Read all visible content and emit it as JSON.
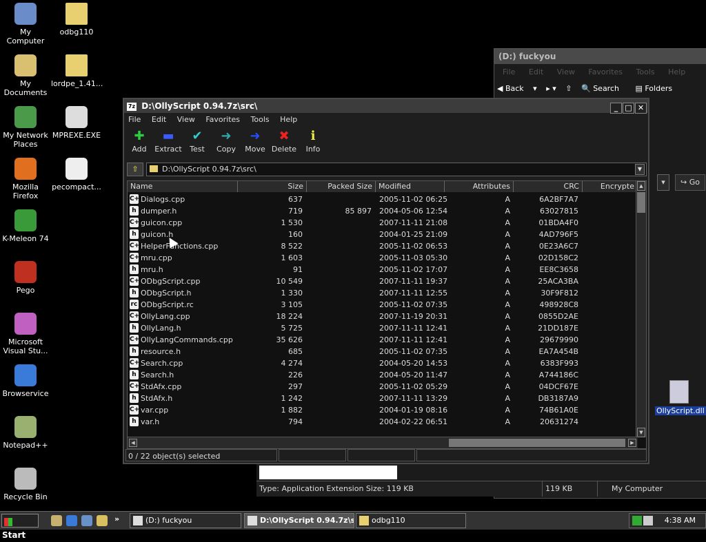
{
  "desktop_icons": [
    {
      "label": "My Computer",
      "icon": "computer-icon"
    },
    {
      "label": "odbg110",
      "icon": "folder-icon"
    },
    {
      "label": "My Documents",
      "icon": "documents-icon"
    },
    {
      "label": "lordpe_1.41...",
      "icon": "folder-icon"
    },
    {
      "label": "My Network Places",
      "icon": "network-icon"
    },
    {
      "label": "MPREXE.EXE",
      "icon": "exe-icon"
    },
    {
      "label": "Mozilla Firefox",
      "icon": "firefox-icon"
    },
    {
      "label": "pecompact...",
      "icon": "pecompact-icon"
    },
    {
      "label": "K-Meleon 74",
      "icon": "kmeleon-icon"
    },
    {
      "label": "Pego",
      "icon": "pego-icon"
    },
    {
      "label": "Microsoft Visual Stu...",
      "icon": "visual-studio-icon"
    },
    {
      "label": "Browservice",
      "icon": "ie-icon"
    },
    {
      "label": "Notepad++",
      "icon": "notepad-icon"
    },
    {
      "label": "Recycle Bin",
      "icon": "recycle-bin-icon"
    }
  ],
  "bg_window": {
    "title": "(D:) fuckyou",
    "menu": [
      "File",
      "Edit",
      "View",
      "Favorites",
      "Tools",
      "Help"
    ],
    "toolbar": {
      "back": "Back",
      "search": "Search",
      "folders": "Folders",
      "go": "Go"
    },
    "status": {
      "type": "Type: Application Extension Size: 119 KB",
      "size": "119 KB",
      "location": "My Computer"
    },
    "file_icon_label": "OllyScript.dll"
  },
  "main_window": {
    "title": "D:\\OllyScript 0.94.7z\\src\\",
    "app_icon_text": "7z",
    "menu": [
      "File",
      "Edit",
      "View",
      "Favorites",
      "Tools",
      "Help"
    ],
    "toolbar": [
      {
        "label": "Add",
        "icon": "plus-icon",
        "glyph": "✚",
        "color": "#2ecc40"
      },
      {
        "label": "Extract",
        "icon": "minus-icon",
        "glyph": "▬",
        "color": "#3a5cff"
      },
      {
        "label": "Test",
        "icon": "check-icon",
        "glyph": "✔",
        "color": "#3cc"
      },
      {
        "label": "Copy",
        "icon": "copy-arrow-icon",
        "glyph": "➜",
        "color": "#3aa"
      },
      {
        "label": "Move",
        "icon": "move-arrow-icon",
        "glyph": "➜",
        "color": "#2a4cff"
      },
      {
        "label": "Delete",
        "icon": "delete-x-icon",
        "glyph": "✖",
        "color": "#e22"
      },
      {
        "label": "Info",
        "icon": "info-icon",
        "glyph": "ℹ",
        "color": "#ee4"
      }
    ],
    "address": "D:\\OllyScript 0.94.7z\\src\\",
    "columns": {
      "name": "Name",
      "size": "Size",
      "packed": "Packed Size",
      "modified": "Modified",
      "attributes": "Attributes",
      "crc": "CRC",
      "encrypted": "Encrypte"
    },
    "files": [
      {
        "name": "Dialogs.cpp",
        "type": "C++",
        "size": "637",
        "packed": "",
        "modified": "2005-11-02 06:25",
        "attr": "A",
        "crc": "6A2BF7A7"
      },
      {
        "name": "dumper.h",
        "type": "h",
        "size": "719",
        "packed": "85 897",
        "modified": "2004-05-06 12:54",
        "attr": "A",
        "crc": "63027815"
      },
      {
        "name": "guicon.cpp",
        "type": "C++",
        "size": "1 530",
        "packed": "",
        "modified": "2007-11-11 21:08",
        "attr": "A",
        "crc": "01BDA4F0"
      },
      {
        "name": "guicon.h",
        "type": "h",
        "size": "160",
        "packed": "",
        "modified": "2004-01-25 21:09",
        "attr": "A",
        "crc": "4AD796F5"
      },
      {
        "name": "HelperFunctions.cpp",
        "type": "C++",
        "size": "8 522",
        "packed": "",
        "modified": "2005-11-02 06:53",
        "attr": "A",
        "crc": "0E23A6C7"
      },
      {
        "name": "mru.cpp",
        "type": "C++",
        "size": "1 603",
        "packed": "",
        "modified": "2005-11-03 05:30",
        "attr": "A",
        "crc": "02D158C2"
      },
      {
        "name": "mru.h",
        "type": "h",
        "size": "91",
        "packed": "",
        "modified": "2005-11-02 17:07",
        "attr": "A",
        "crc": "EE8C3658"
      },
      {
        "name": "ODbgScript.cpp",
        "type": "C++",
        "size": "10 549",
        "packed": "",
        "modified": "2007-11-11 19:37",
        "attr": "A",
        "crc": "25ACA3BA"
      },
      {
        "name": "ODbgScript.h",
        "type": "h",
        "size": "1 330",
        "packed": "",
        "modified": "2007-11-11 12:55",
        "attr": "A",
        "crc": "30F9F812"
      },
      {
        "name": "ODbgScript.rc",
        "type": "rc",
        "size": "3 105",
        "packed": "",
        "modified": "2005-11-02 07:35",
        "attr": "A",
        "crc": "498928C8"
      },
      {
        "name": "OllyLang.cpp",
        "type": "C++",
        "size": "18 224",
        "packed": "",
        "modified": "2007-11-19 20:31",
        "attr": "A",
        "crc": "0855D2AE"
      },
      {
        "name": "OllyLang.h",
        "type": "h",
        "size": "5 725",
        "packed": "",
        "modified": "2007-11-11 12:41",
        "attr": "A",
        "crc": "21DD187E"
      },
      {
        "name": "OllyLangCommands.cpp",
        "type": "C++",
        "size": "35 626",
        "packed": "",
        "modified": "2007-11-11 12:41",
        "attr": "A",
        "crc": "29679990"
      },
      {
        "name": "resource.h",
        "type": "h",
        "size": "685",
        "packed": "",
        "modified": "2005-11-02 07:35",
        "attr": "A",
        "crc": "EA7A454B"
      },
      {
        "name": "Search.cpp",
        "type": "C++",
        "size": "4 274",
        "packed": "",
        "modified": "2004-05-20 14:53",
        "attr": "A",
        "crc": "6383F993"
      },
      {
        "name": "Search.h",
        "type": "h",
        "size": "226",
        "packed": "",
        "modified": "2004-05-20 11:47",
        "attr": "A",
        "crc": "A744186C"
      },
      {
        "name": "StdAfx.cpp",
        "type": "C++",
        "size": "297",
        "packed": "",
        "modified": "2005-11-02 05:29",
        "attr": "A",
        "crc": "04DCF67E"
      },
      {
        "name": "StdAfx.h",
        "type": "h",
        "size": "1 242",
        "packed": "",
        "modified": "2007-11-11 13:29",
        "attr": "A",
        "crc": "DB3187A9"
      },
      {
        "name": "var.cpp",
        "type": "C++",
        "size": "1 882",
        "packed": "",
        "modified": "2004-01-19 08:16",
        "attr": "A",
        "crc": "74B61A0E"
      },
      {
        "name": "var.h",
        "type": "h",
        "size": "794",
        "packed": "",
        "modified": "2004-02-22 06:51",
        "attr": "A",
        "crc": "20631274"
      }
    ],
    "status": "0 / 22 object(s) selected"
  },
  "taskbar": {
    "start": "Start",
    "tasks": [
      {
        "label": "(D:) fuckyou",
        "active": false
      },
      {
        "label": "D:\\OllyScript 0.94.7z\\s...",
        "active": true
      },
      {
        "label": "odbg110",
        "active": false
      }
    ],
    "clock": "4:38 AM"
  }
}
